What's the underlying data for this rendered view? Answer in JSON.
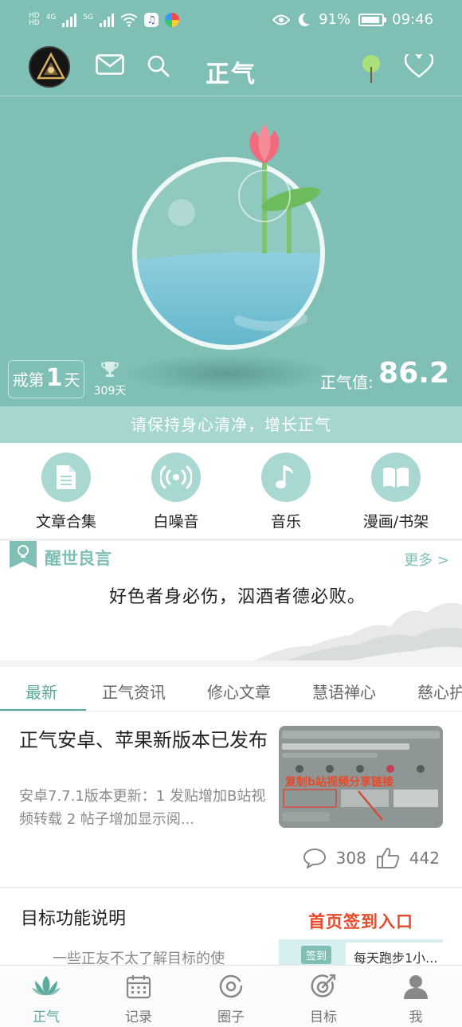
{
  "status_bar": {
    "network_1": "4G",
    "network_2": "5G",
    "hd": "HD",
    "battery": "91%",
    "time": "09:46"
  },
  "header": {
    "title": "正气"
  },
  "hero": {
    "quit_prefix": "戒第",
    "quit_days": "1",
    "quit_suffix": "天",
    "best_days": "309天",
    "zhengqi_label": "正气值:",
    "zhengqi_value": "86.2",
    "slogan": "请保持身心清净，增长正气"
  },
  "shortcuts": [
    {
      "label": "文章合集",
      "icon": "document-icon"
    },
    {
      "label": "白噪音",
      "icon": "broadcast-icon"
    },
    {
      "label": "音乐",
      "icon": "music-note-icon"
    },
    {
      "label": "漫画/书架",
      "icon": "open-book-icon"
    }
  ],
  "quote": {
    "title": "醒世良言",
    "more": "更多 >",
    "text": "好色者身必伤，泅酒者德必败。"
  },
  "tabs": [
    "最新",
    "正气资讯",
    "修心文章",
    "慧语禅心",
    "慈心护"
  ],
  "articles": [
    {
      "title": "正气安卓、苹果新版本已发布",
      "summary": "安卓7.7.1版本更新：1 发贴增加B站视频转载 2 帖子增加显示阅...",
      "thumb_text": "复制b站视频分享链接",
      "comments": "308",
      "likes": "442"
    },
    {
      "title": "目标功能说明",
      "summary": "一些正友不太了解目标的使",
      "thumb_head": "首页签到入口",
      "thumb_signin": "签到",
      "thumb_card": "每天跑步1小..."
    }
  ],
  "bottom_nav": [
    {
      "label": "正气",
      "icon": "lotus-icon",
      "active": true
    },
    {
      "label": "记录",
      "icon": "calendar-icon",
      "active": false
    },
    {
      "label": "圈子",
      "icon": "circle-icon",
      "active": false
    },
    {
      "label": "目标",
      "icon": "target-icon",
      "active": false
    },
    {
      "label": "我",
      "icon": "person-icon",
      "active": false
    }
  ],
  "colors": {
    "theme": "#7fbfb6",
    "theme_light": "#a5d6cf",
    "accent": "#5aaa9f",
    "highlight_red": "#e64a2a"
  }
}
